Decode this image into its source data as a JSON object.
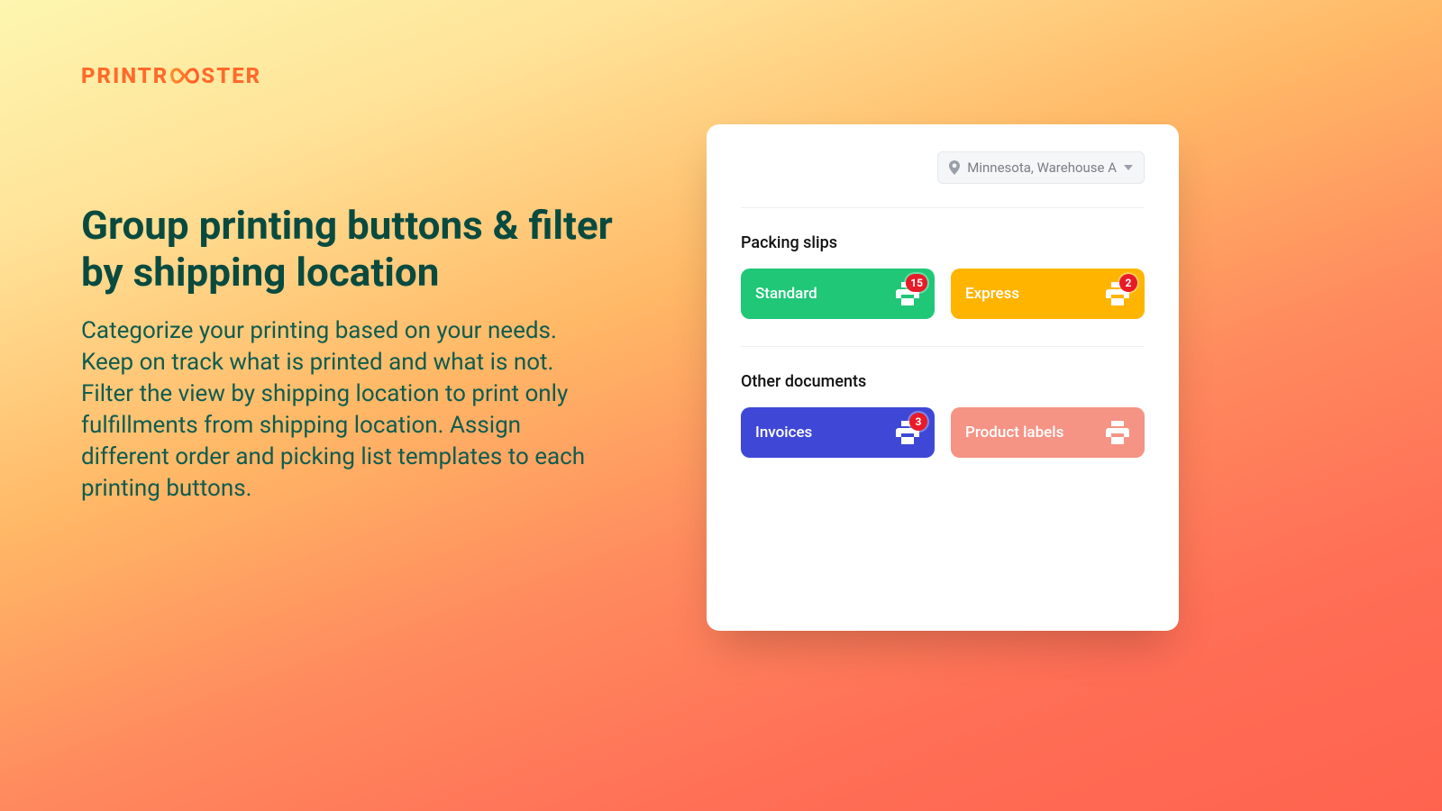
{
  "brand": {
    "pre": "PRINTR",
    "post": "STER"
  },
  "hero": {
    "title": "Group printing buttons & filter by shipping location",
    "body": "Categorize your printing based on your needs. Keep on track what is printed and what is not. Filter the view by shipping location to print only fulfillments from shipping location. Assign different order and picking list templates to each printing buttons."
  },
  "panel": {
    "location": "Minnesota, Warehouse A",
    "sections": {
      "packing": {
        "title": "Packing slips",
        "buttons": {
          "standard": {
            "label": "Standard",
            "count": "15",
            "color": "#1fc777"
          },
          "express": {
            "label": "Express",
            "count": "2",
            "color": "#ffb400"
          }
        }
      },
      "other": {
        "title": "Other documents",
        "buttons": {
          "invoices": {
            "label": "Invoices",
            "count": "3",
            "color": "#3f48d6"
          },
          "labels": {
            "label": "Product labels",
            "count": "",
            "color": "#f59384"
          }
        }
      }
    }
  }
}
